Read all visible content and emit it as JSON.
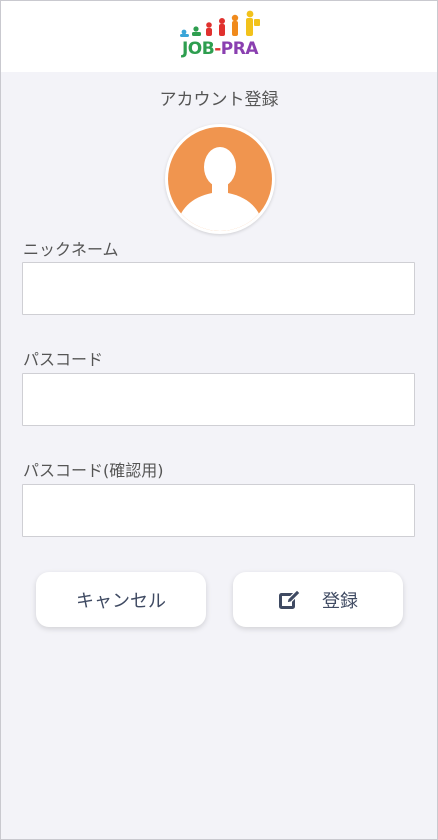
{
  "header": {
    "logo": {
      "text_parts": [
        "JOB",
        "-",
        "PRA"
      ],
      "alt": "JOB-PRA"
    }
  },
  "page": {
    "title": "アカウント登録"
  },
  "avatar": {
    "icon": "user-silhouette-icon",
    "color": "#f0954f"
  },
  "form": {
    "nickname": {
      "label": "ニックネーム",
      "value": "",
      "placeholder": ""
    },
    "passcode": {
      "label": "パスコード",
      "value": "",
      "placeholder": ""
    },
    "passcode_confirm": {
      "label": "パスコード(確認用)",
      "value": "",
      "placeholder": ""
    }
  },
  "buttons": {
    "cancel_label": "キャンセル",
    "register_label": "登録",
    "register_icon": "edit-icon"
  },
  "colors": {
    "background": "#f3f3f8",
    "avatar_orange": "#f0954f",
    "button_text": "#3f4a62"
  }
}
